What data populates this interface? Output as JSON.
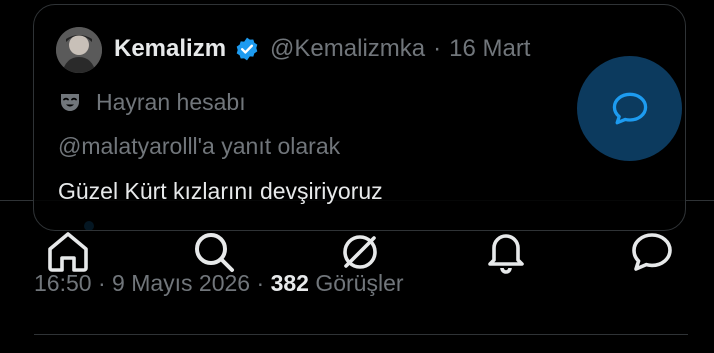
{
  "quote": {
    "display_name": "Kemalizm",
    "handle": "@Kemalizmka",
    "separator": "·",
    "date": "16 Mart",
    "fan_label": "Hayran hesabı",
    "reply_to": "@malatyarolll'a yanıt olarak",
    "text": "Güzel Kürt kızlarını devşiriyoruz"
  },
  "meta": {
    "time": "16:50",
    "separator": "·",
    "date": "9 Mayıs 2026",
    "separator2": "·",
    "views_count": "382",
    "views_label": "Görüşler"
  },
  "nav": {
    "items": [
      "home-icon",
      "search-icon",
      "grok-icon",
      "notifications-icon",
      "messages-icon"
    ]
  },
  "colors": {
    "accent": "#1d9bf0",
    "muted": "#71767b",
    "text": "#e7e9ea",
    "fab": "#0c3a5e"
  }
}
